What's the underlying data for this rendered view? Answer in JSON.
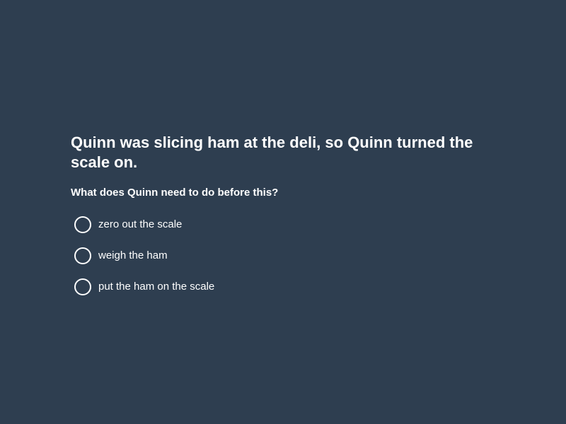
{
  "question": {
    "context": "Quinn was slicing ham at the deli, so Quinn turned the scale on.",
    "prompt": "What does Quinn need to do before this?",
    "options": [
      {
        "label": "zero out the scale"
      },
      {
        "label": "weigh the ham"
      },
      {
        "label": "put the ham on the scale"
      }
    ]
  },
  "colors": {
    "background": "#2e3e50",
    "text": "#ffffff"
  }
}
